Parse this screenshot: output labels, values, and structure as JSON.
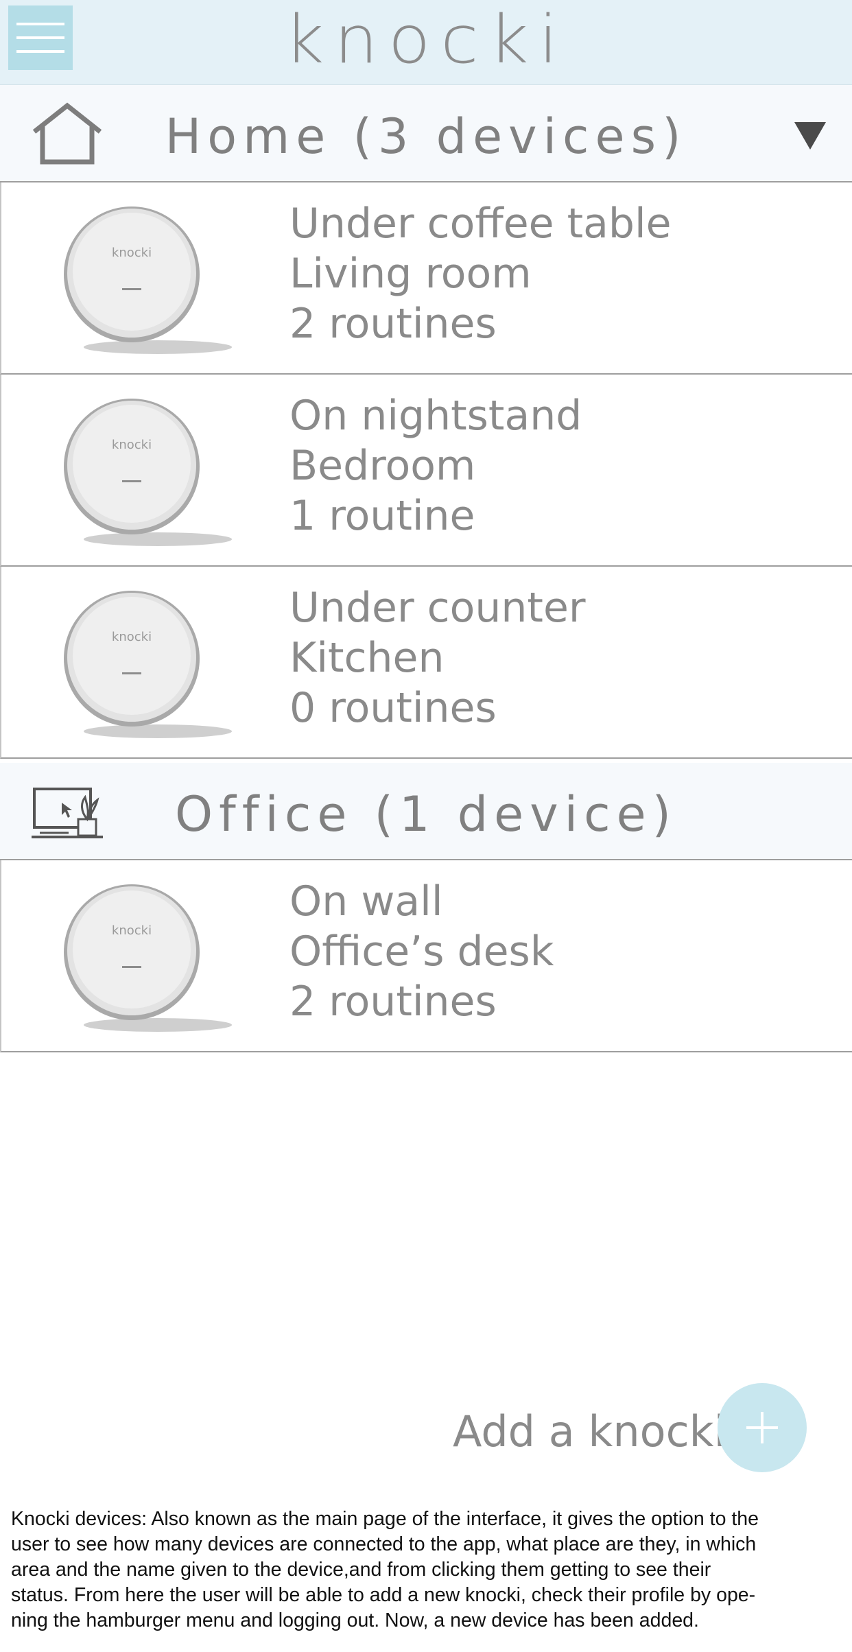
{
  "app": {
    "brand": "knocki"
  },
  "header": {
    "menu_icon": "hamburger-menu-icon"
  },
  "sections": [
    {
      "title": "Home (3 devices)",
      "icon": "house-icon",
      "toggle_icon": "triangle-down-icon",
      "devices": [
        {
          "device_label": "knocki",
          "location": "Under coffee table",
          "room": "Living room",
          "routines": "2 routines"
        },
        {
          "device_label": "knocki",
          "location": "On nightstand",
          "room": "Bedroom",
          "routines": "1 routine"
        },
        {
          "device_label": "knocki",
          "location": "Under counter",
          "room": "Kitchen",
          "routines": "0 routines"
        }
      ]
    },
    {
      "title": "Office (1 device)",
      "icon": "desktop-plant-icon",
      "devices": [
        {
          "device_label": "knocki",
          "location": "On wall",
          "room": "Office’s desk",
          "routines": "2 routines"
        }
      ]
    }
  ],
  "footer": {
    "add_label": "Add a knocki",
    "add_icon": "plus-icon",
    "accent_color": "#c8e7ef"
  },
  "caption": [
    "Knocki devices: Also known as the main page of the interface, it gives the option to the",
    "user to see how many devices are connected to the app, what place are they, in which",
    "area and the name given to the device,and from clicking them getting to see their",
    "status. From here the user will be able to add a new knocki, check their profile by ope-",
    "ning the hamburger menu and logging out. Now, a new device has been added."
  ]
}
